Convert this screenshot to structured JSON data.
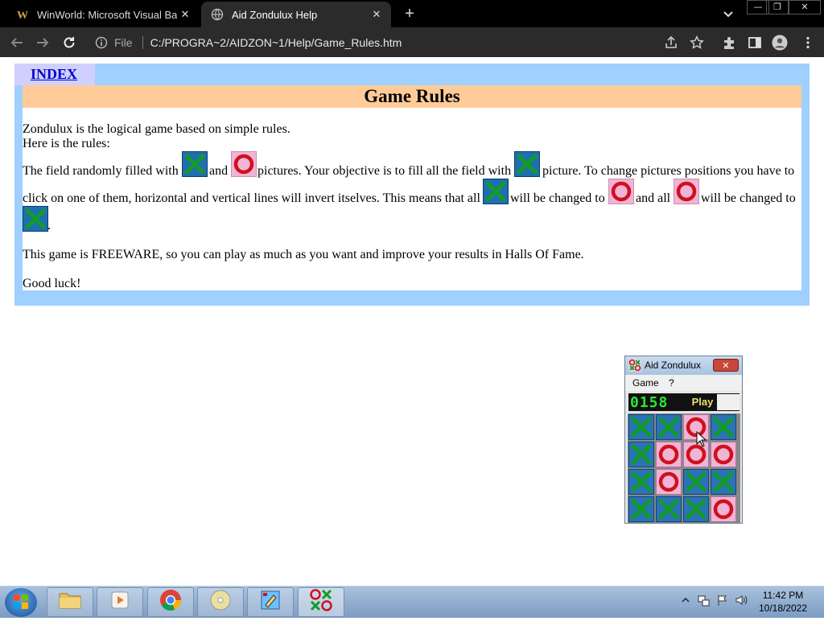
{
  "browser": {
    "tabs": [
      {
        "title": "WinWorld: Microsoft Visual Basic",
        "close": "✕"
      },
      {
        "title": "Aid Zondulux Help",
        "close": "✕"
      }
    ],
    "new_tab": "+",
    "window_controls": {
      "minimize": "—",
      "restore": "❐",
      "close": "✕"
    },
    "file_label": "File",
    "url": "C:/PROGRA~2/AIDZON~1/Help/Game_Rules.htm"
  },
  "page": {
    "index_link": "INDEX",
    "title": "Game Rules",
    "line1": "Zondulux is the logical game based on simple rules.",
    "line2": "Here is the rules:",
    "p1_a": "The field randomly filled with",
    "p1_b": "and",
    "p1_c": "pictures. Your objective is to fill all the field with",
    "p1_d": "picture. To change pictures positions you have to",
    "p2_a": "click on one of them, horizontal and vertical lines will invert itselves. This means that all",
    "p2_b": "will be changed to",
    "p2_c": "and all",
    "p2_d": "will be changed to",
    "p3_end": ".",
    "freeware": "This game is FREEWARE, so you can play as much as you want and improve your results in Halls Of Fame.",
    "good_luck": "Good luck!"
  },
  "game_window": {
    "title": "Aid Zondulux",
    "close": "✕",
    "menu": [
      "Game",
      "?"
    ],
    "timer": "0158",
    "play_label": "Play",
    "grid": [
      [
        "x",
        "x",
        "o",
        "x"
      ],
      [
        "x",
        "o",
        "o",
        "o"
      ],
      [
        "x",
        "o",
        "x",
        "x"
      ],
      [
        "x",
        "x",
        "x",
        "o"
      ]
    ]
  },
  "taskbar": {
    "apps": [
      "file-explorer",
      "media-player",
      "chrome",
      "disc",
      "paint",
      "zondulux"
    ],
    "clock_time": "11:42 PM",
    "clock_date": "10/18/2022"
  },
  "colors": {
    "x_tile": "#2a73b8",
    "x_mark": "#139a2a",
    "o_tile": "#f0b4d6",
    "o_mark": "#d0101c",
    "outer_table": "#9fd0ff",
    "title_bar": "#ffcc99",
    "index_cell": "#d0d0ff"
  }
}
